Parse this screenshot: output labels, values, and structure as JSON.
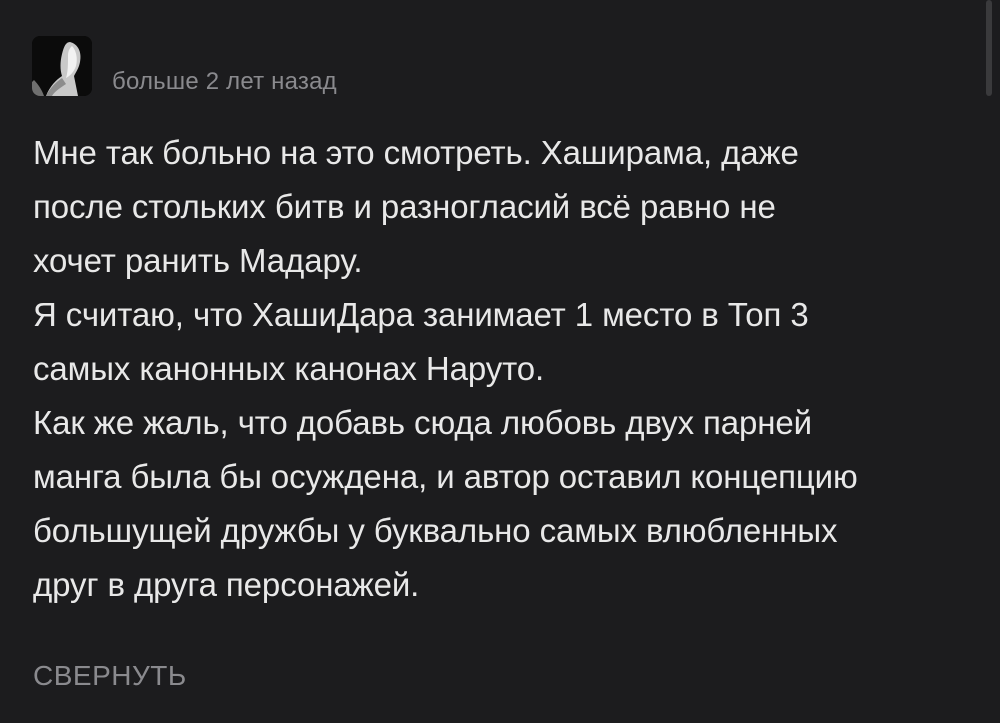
{
  "comment": {
    "author_avatar_icon": "user-avatar-image",
    "timestamp": "больше 2 лет назад",
    "body_lines": [
      "Мне так больно на это смотреть. Хаширама, даже",
      "после стольких битв и разногласий всё равно не",
      "хочет ранить Мадару.",
      "Я считаю, что ХашиДара занимает 1 место в Топ 3",
      "самых канонных канонах Наруто.",
      "Как же жаль, что добавь сюда любовь двух парней",
      "манга была бы осуждена, и автор оставил концепцию",
      "большущей дружбы у буквально самых влюбленных",
      "друг в друга персонажей."
    ],
    "collapse_label": "СВЕРНУТЬ"
  },
  "colors": {
    "background": "#1c1c1e",
    "text_primary": "#e8e8e8",
    "text_secondary": "#8a8a8e"
  }
}
